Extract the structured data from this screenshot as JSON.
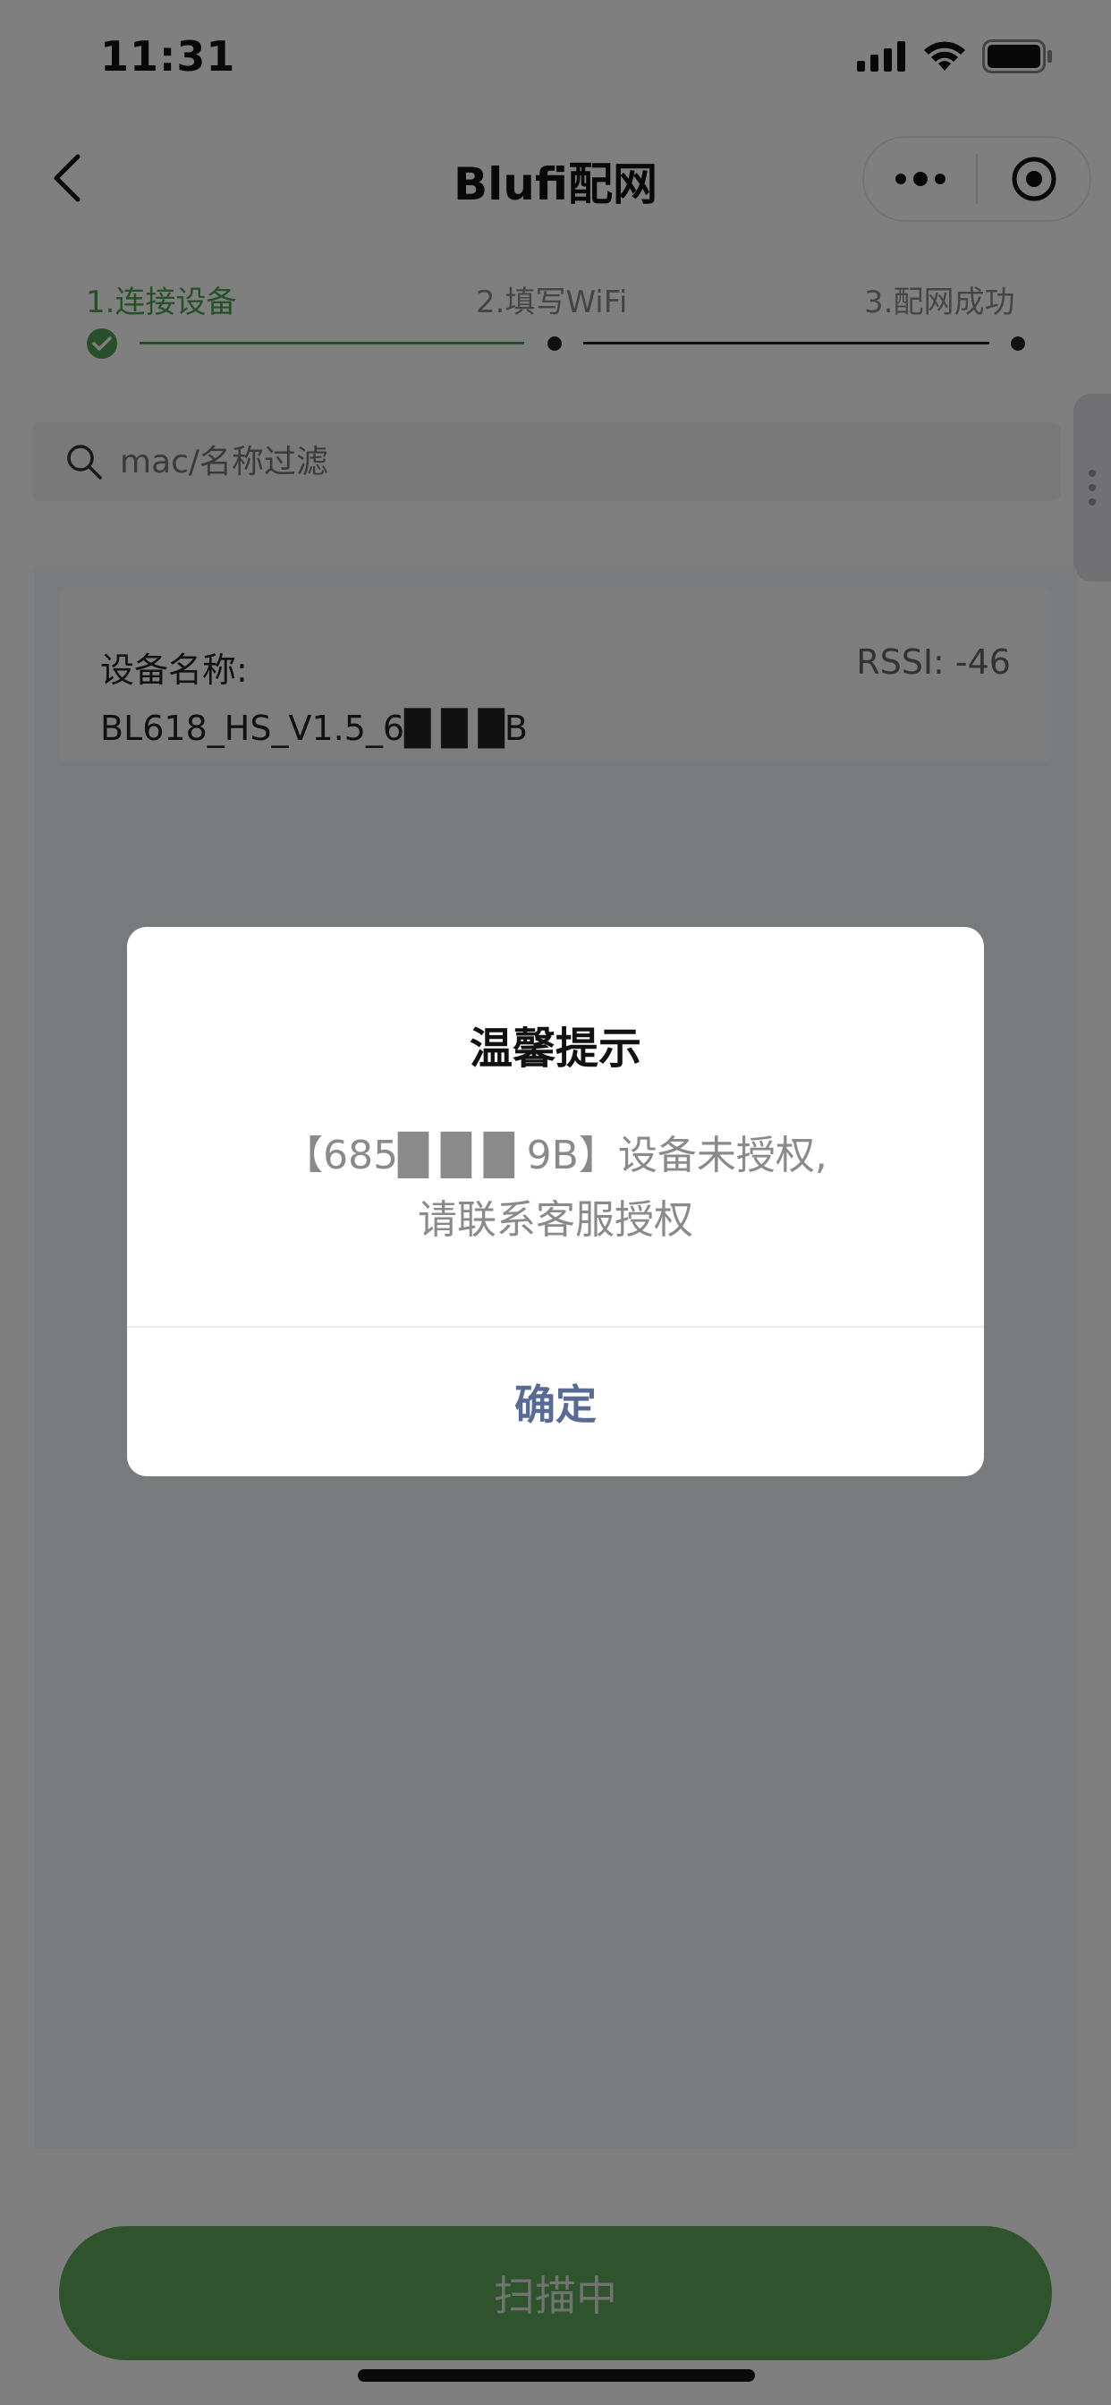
{
  "status_bar": {
    "time": "11:31"
  },
  "nav": {
    "title": "Blufi配网"
  },
  "steps": {
    "items": [
      {
        "label": "1.连接设备",
        "state": "done"
      },
      {
        "label": "2.填写WiFi",
        "state": "pending"
      },
      {
        "label": "3.配网成功",
        "state": "pending"
      }
    ]
  },
  "search": {
    "placeholder": "mac/名称过滤"
  },
  "device_list": [
    {
      "label": "设备名称:",
      "name": "BL618_HS_V1.5_6█ █ █B",
      "rssi": "RSSI: -46"
    }
  ],
  "scan_button": {
    "label": "扫描中"
  },
  "modal": {
    "title": "温馨提示",
    "message_line1": "【685█ █ █ 9B】设备未授权,",
    "message_line2": "请联系客服授权",
    "confirm_label": "确定"
  },
  "colors": {
    "accent_green": "#4fa155",
    "modal_link": "#576b95"
  }
}
